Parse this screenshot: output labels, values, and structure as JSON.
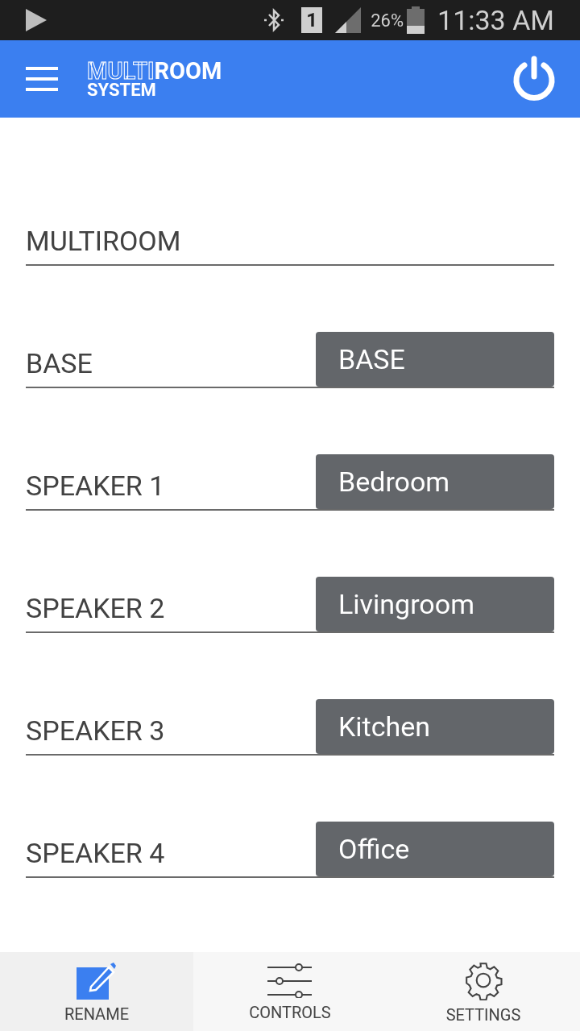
{
  "status_bar": {
    "battery": "26%",
    "time": "11:33 AM",
    "sim": "1"
  },
  "app_bar": {
    "logo_outline": "MULTI",
    "logo_bold": "ROOM",
    "logo_sub": "SYSTEM"
  },
  "title_field": {
    "value": "MULTIROOM"
  },
  "rows": [
    {
      "label": "BASE",
      "value": "BASE"
    },
    {
      "label": "SPEAKER 1",
      "value": "Bedroom"
    },
    {
      "label": "SPEAKER 2",
      "value": "Livingroom"
    },
    {
      "label": "SPEAKER 3",
      "value": "Kitchen"
    },
    {
      "label": "SPEAKER 4",
      "value": "Office"
    }
  ],
  "tabs": [
    {
      "kind": "rename",
      "label": "RENAME",
      "selected": true
    },
    {
      "kind": "controls",
      "label": "CONTROLS",
      "selected": false
    },
    {
      "kind": "settings",
      "label": "SETTINGS",
      "selected": false
    }
  ]
}
